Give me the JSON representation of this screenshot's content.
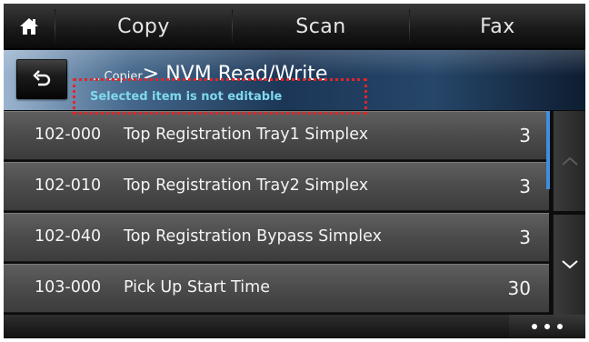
{
  "nav": {
    "home_icon": "home-icon",
    "tabs": [
      "Copy",
      "Scan",
      "Fax"
    ]
  },
  "header": {
    "back_icon": "back-arrow-icon",
    "breadcrumb_prefix": "... Copier",
    "title": "> NVM Read/Write",
    "notice": "Selected item is not editable",
    "notice_highlight_color": "#e0262a"
  },
  "list": {
    "rows": [
      {
        "code": "102-000",
        "label": "Top Registration Tray1 Simplex",
        "value": "3"
      },
      {
        "code": "102-010",
        "label": "Top Registration Tray2 Simplex",
        "value": "3"
      },
      {
        "code": "102-040",
        "label": "Top Registration Bypass Simplex",
        "value": "3"
      },
      {
        "code": "103-000",
        "label": "Pick Up Start Time",
        "value": "30"
      }
    ],
    "scroll_up_icon": "chevron-up-icon",
    "scroll_down_icon": "chevron-down-icon",
    "scroll_accent": "#3f8fe0"
  },
  "footer": {
    "more_icon": "more-dots-icon"
  }
}
